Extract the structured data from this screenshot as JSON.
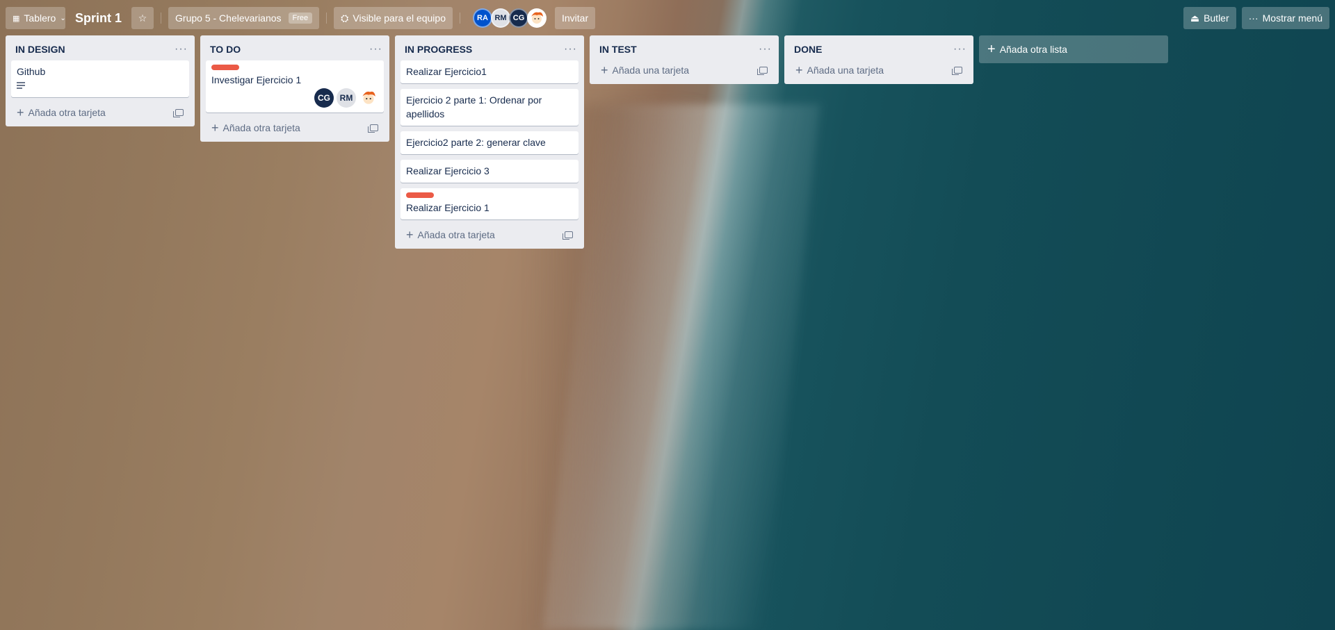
{
  "header": {
    "view_switcher": "Tablero",
    "board_title": "Sprint 1",
    "workspace": "Grupo 5 - Chelevarianos",
    "workspace_badge": "Free",
    "visibility": "Visible para el equipo",
    "members": [
      {
        "initials": "RA",
        "color": "#0052cc"
      },
      {
        "initials": "RM",
        "color": "#dfe1e6"
      },
      {
        "initials": "CG",
        "color": "#172b4d"
      },
      {
        "initials": "",
        "icon": "cartoon-avatar"
      }
    ],
    "invite": "Invitar",
    "butler": "Butler",
    "show_menu": "Mostrar menú"
  },
  "lists": [
    {
      "title": "IN DESIGN",
      "cards": [
        {
          "title": "Github",
          "label": null,
          "has_description": true
        }
      ],
      "add_card": "Añada otra tarjeta"
    },
    {
      "title": "TO DO",
      "cards": [
        {
          "title": "Investigar Ejercicio 1",
          "label": "red",
          "members": [
            "CG",
            "RM",
            "cartoon-avatar"
          ]
        }
      ],
      "add_card": "Añada otra tarjeta"
    },
    {
      "title": "IN PROGRESS",
      "cards": [
        {
          "title": "Realizar Ejercicio1"
        },
        {
          "title": "Ejercicio 2 parte 1: Ordenar por apellidos"
        },
        {
          "title": "Ejercicio2 parte 2: generar clave"
        },
        {
          "title": "Realizar Ejercicio 3"
        },
        {
          "title": "Realizar Ejercicio 1",
          "label": "red"
        }
      ],
      "add_card": "Añada otra tarjeta"
    },
    {
      "title": "IN TEST",
      "cards": [],
      "add_card": "Añada una tarjeta"
    },
    {
      "title": "DONE",
      "cards": [],
      "add_card": "Añada una tarjeta"
    }
  ],
  "add_list": "Añada otra lista",
  "colors": {
    "label_red": "#eb5a46",
    "list_bg": "#ebecf0"
  }
}
